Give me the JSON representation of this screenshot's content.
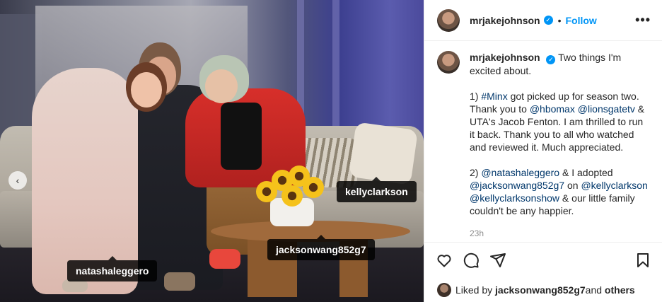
{
  "post": {
    "username": "mrjakejohnson",
    "follow_label": "Follow",
    "dot": "•",
    "more_label": "•••",
    "verified_mark": "✓",
    "caption": {
      "p1": "Two things I'm excited about.",
      "p2_prefix": "1) ",
      "p2_tag_minx": "#Minx",
      "p2_mid1": " got picked up for season two. Thank you to ",
      "p2_mention_hbomax": "@hbomax",
      "p2_space": " ",
      "p2_mention_lionsgate": "@lionsgatetv",
      "p2_rest": " & UTA's Jacob Fenton. I am thrilled to run it back. Thank you to all who watched and reviewed it. Much appreciated.",
      "p3_prefix": "2) ",
      "p3_mention_natasha": "@natashaleggero",
      "p3_mid1": " & I adopted ",
      "p3_mention_jackson": "@jacksonwang852g7",
      "p3_mid2": " on ",
      "p3_mention_kelly": "@kellyclarkson",
      "p3_mention_kellyshow": "@kellyclarksonshow",
      "p3_rest": " & our little family couldn't be any happier."
    },
    "time_ago": "23h",
    "likes": {
      "prefix": "Liked by ",
      "user": "jacksonwang852g7",
      "and": " and ",
      "others": "others"
    }
  },
  "photo": {
    "tags": {
      "kelly": "kellyclarkson",
      "jackson": "jacksonwang852g7",
      "natasha": "natashaleggero"
    },
    "prev_icon": "‹"
  },
  "icons": {
    "like": "heart-icon",
    "comment": "comment-icon",
    "share": "share-icon",
    "save": "bookmark-icon"
  },
  "colors": {
    "link": "#00376b",
    "follow": "#0095f6",
    "muted": "#8e8e8e"
  }
}
